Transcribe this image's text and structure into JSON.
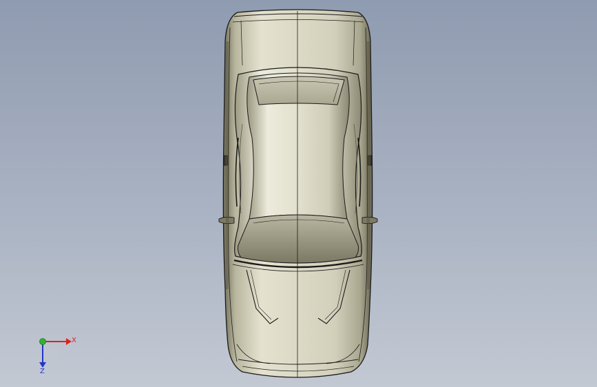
{
  "viewport": {
    "background_top": "#8f9bb0",
    "background_bottom": "#c3c9d3"
  },
  "model": {
    "body_color": "#d9d7c2",
    "shade_color": "#8c8a73",
    "edge_color": "#1a1a1a"
  },
  "triad": {
    "x_label": "X",
    "z_label": "Z",
    "x_color": "#e0201c",
    "y_color": "#2fb52f",
    "z_color": "#2433c8"
  }
}
